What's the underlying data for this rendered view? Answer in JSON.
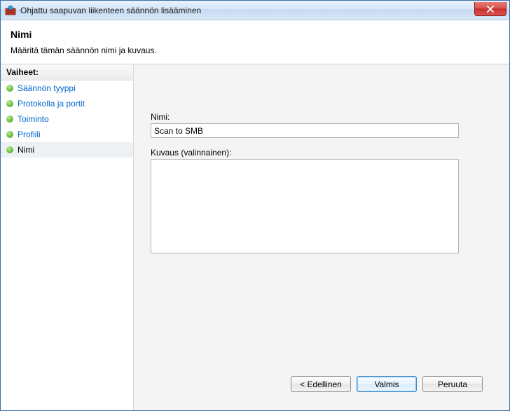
{
  "window": {
    "title": "Ohjattu saapuvan liikenteen säännön lisääminen"
  },
  "header": {
    "title": "Nimi",
    "subtitle": "Määritä tämän säännön nimi ja kuvaus."
  },
  "sidebar": {
    "header": "Vaiheet:",
    "steps": [
      {
        "label": "Säännön tyyppi",
        "link": true,
        "current": false
      },
      {
        "label": "Protokolla ja portit",
        "link": true,
        "current": false
      },
      {
        "label": "Toiminto",
        "link": true,
        "current": false
      },
      {
        "label": "Profiili",
        "link": true,
        "current": false
      },
      {
        "label": "Nimi",
        "link": false,
        "current": true
      }
    ]
  },
  "form": {
    "name_label": "Nimi:",
    "name_value": "Scan to SMB",
    "desc_label": "Kuvaus (valinnainen):",
    "desc_value": ""
  },
  "buttons": {
    "back": "< Edellinen",
    "finish": "Valmis",
    "cancel": "Peruuta"
  }
}
